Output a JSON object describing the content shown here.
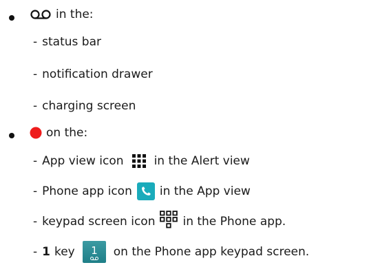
{
  "items": [
    {
      "label": "in the:",
      "icon": "voicemail-icon",
      "subs": [
        "status bar",
        "notification drawer",
        "charging screen"
      ]
    },
    {
      "label": "on the:",
      "icon": "red-dot-icon",
      "icon_color": "#ee1c1c",
      "subs": [
        {
          "pre": "App view icon",
          "icon": "grid-icon",
          "post": "in the Alert view"
        },
        {
          "pre": "Phone app icon",
          "icon": "phone-app-icon",
          "icon_color": "#1aabbb",
          "post": "in the App view"
        },
        {
          "pre": "keypad screen icon",
          "icon": "dialpad-icon",
          "post": "in the Phone app."
        },
        {
          "bold": "1",
          "pre": "key",
          "icon": "one-key-icon",
          "key_color": "#2a8a92",
          "key_label": "1",
          "post": "on the Phone app keypad screen."
        }
      ]
    }
  ],
  "dash": "-"
}
